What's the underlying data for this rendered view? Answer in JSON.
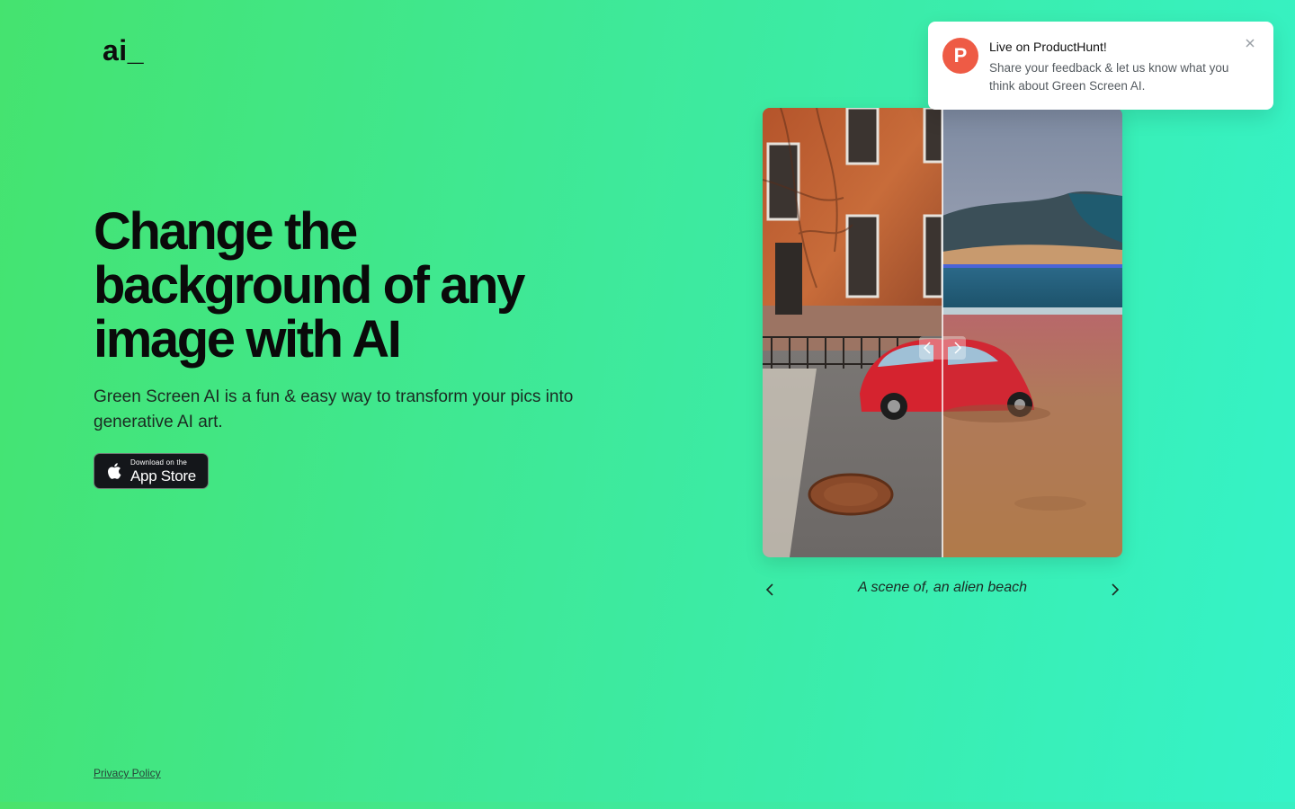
{
  "brand": {
    "logo": "ai_"
  },
  "hero": {
    "title": "Change the background of any image with AI",
    "subtitle": "Green Screen AI is a fun & easy way to transform your pics into generative AI art."
  },
  "app_store": {
    "small_label": "Download on the",
    "big_label": "App Store",
    "icon": "apple-icon"
  },
  "footer": {
    "privacy_label": "Privacy Policy"
  },
  "carousel": {
    "caption": "A scene of, an alien beach",
    "prev_icon": "chevron-left-icon",
    "next_icon": "chevron-right-icon"
  },
  "toast": {
    "avatar_letter": "P",
    "title": "Live on ProductHunt!",
    "body": "Share your feedback & let us know what you think about Green Screen AI.",
    "close_icon": "close-icon"
  },
  "colors": {
    "bg_start": "#45e36f",
    "bg_end": "#35f3c9",
    "producthunt": "#ee5b45",
    "button_dark": "#14161a"
  }
}
